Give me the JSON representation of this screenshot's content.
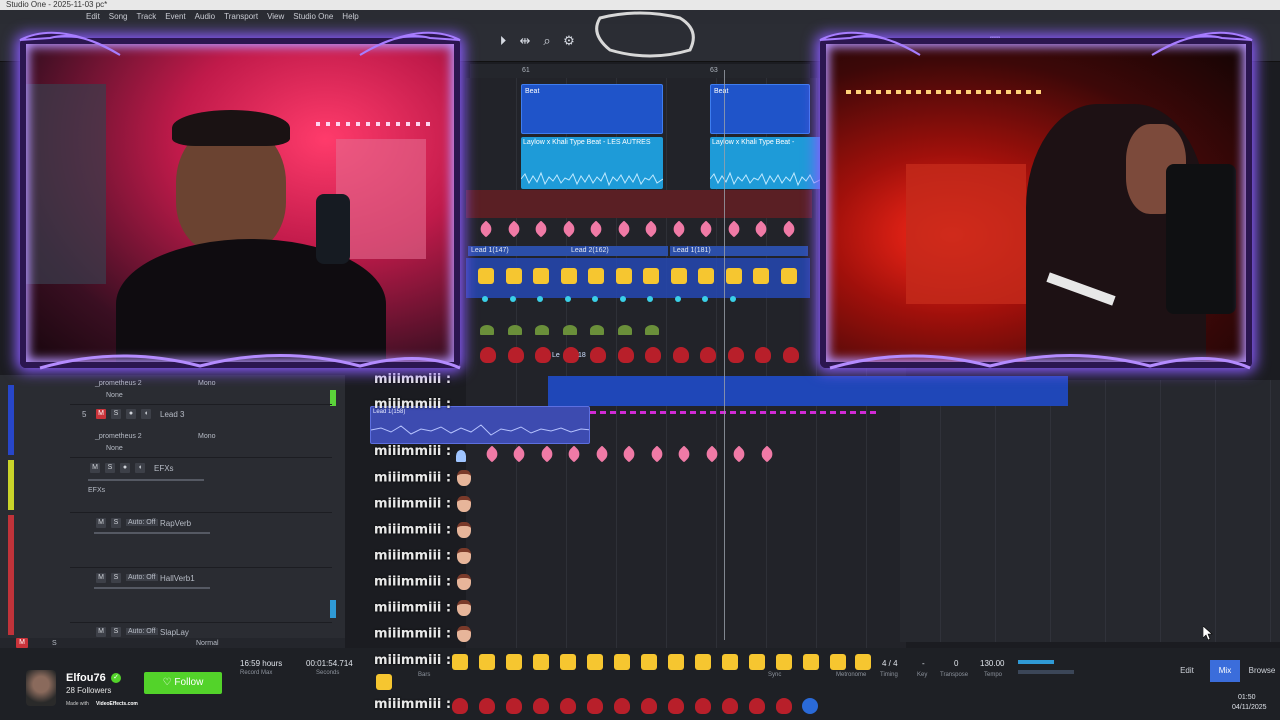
{
  "window": {
    "title": "Studio One - 2025-11-03 pc*",
    "menus": [
      "Edit",
      "Song",
      "Track",
      "Event",
      "Audio",
      "Transport",
      "View",
      "Studio One",
      "Help"
    ]
  },
  "ruler": {
    "markers": [
      "61",
      "63"
    ]
  },
  "arrangement": {
    "beat_clips": [
      {
        "name": "Beat"
      },
      {
        "name": "Beat"
      }
    ],
    "audio_clips": [
      {
        "name": "Laylow x Khali Type Beat - LES AUTRES"
      },
      {
        "name": "Laylow x Khali Type Beat -"
      }
    ],
    "lead_regions": [
      "Lead 1(147)",
      "Lead 2(162)",
      "Lead 1(181)"
    ],
    "small_region_labels": [
      "Le",
      "18",
      "Lead 1(158)"
    ]
  },
  "chat": {
    "username": "miiimmiii",
    "separator": ":"
  },
  "tracks": [
    {
      "number": "",
      "name": "_prometheus 2",
      "mode": "Mono",
      "insert": "None"
    },
    {
      "number": "5",
      "name": "Lead 3",
      "plugin": "_prometheus 2",
      "mode": "Mono",
      "insert": "None"
    },
    {
      "number": "",
      "name": "EFXs",
      "output": "EFXs"
    },
    {
      "number": "",
      "name": "RapVerb",
      "auto": "Auto: Off"
    },
    {
      "number": "",
      "name": "HallVerb1",
      "auto": "Auto: Off"
    },
    {
      "number": "",
      "name": "SlapLay",
      "auto": "Auto: Off"
    }
  ],
  "buttons": {
    "mute": "M",
    "solo": "S"
  },
  "statusbar": {
    "mode": "Normal",
    "m": "M",
    "s": "S"
  },
  "transport": {
    "record_max": "16:59 hours",
    "record_max_label": "Record Max",
    "time": "00:01:54.714",
    "time_unit": "Seconds",
    "timing": "4 / 4",
    "timing_label": "Timing",
    "key": "-",
    "key_label": "Key",
    "transpose": "0",
    "transpose_label": "Transpose",
    "tempo": "130.00",
    "tempo_label": "Tempo",
    "bars_label": "Bars",
    "sync_label": "Sync",
    "metronome_label": "Metronome"
  },
  "tabs": {
    "edit": "Edit",
    "mix": "Mix",
    "browse": "Browse"
  },
  "clock": {
    "time": "01:50",
    "date": "04/11/2025"
  },
  "streamer": {
    "name": "Elfou76",
    "followers": "28 Followers",
    "follow_label": "Follow",
    "made_with": "Made with",
    "brand": "VideoEffects.com"
  },
  "colors": {
    "accent_blue": "#3b6ddb",
    "follow_green": "#53d32a",
    "frame_purple": "#8a5cff"
  }
}
